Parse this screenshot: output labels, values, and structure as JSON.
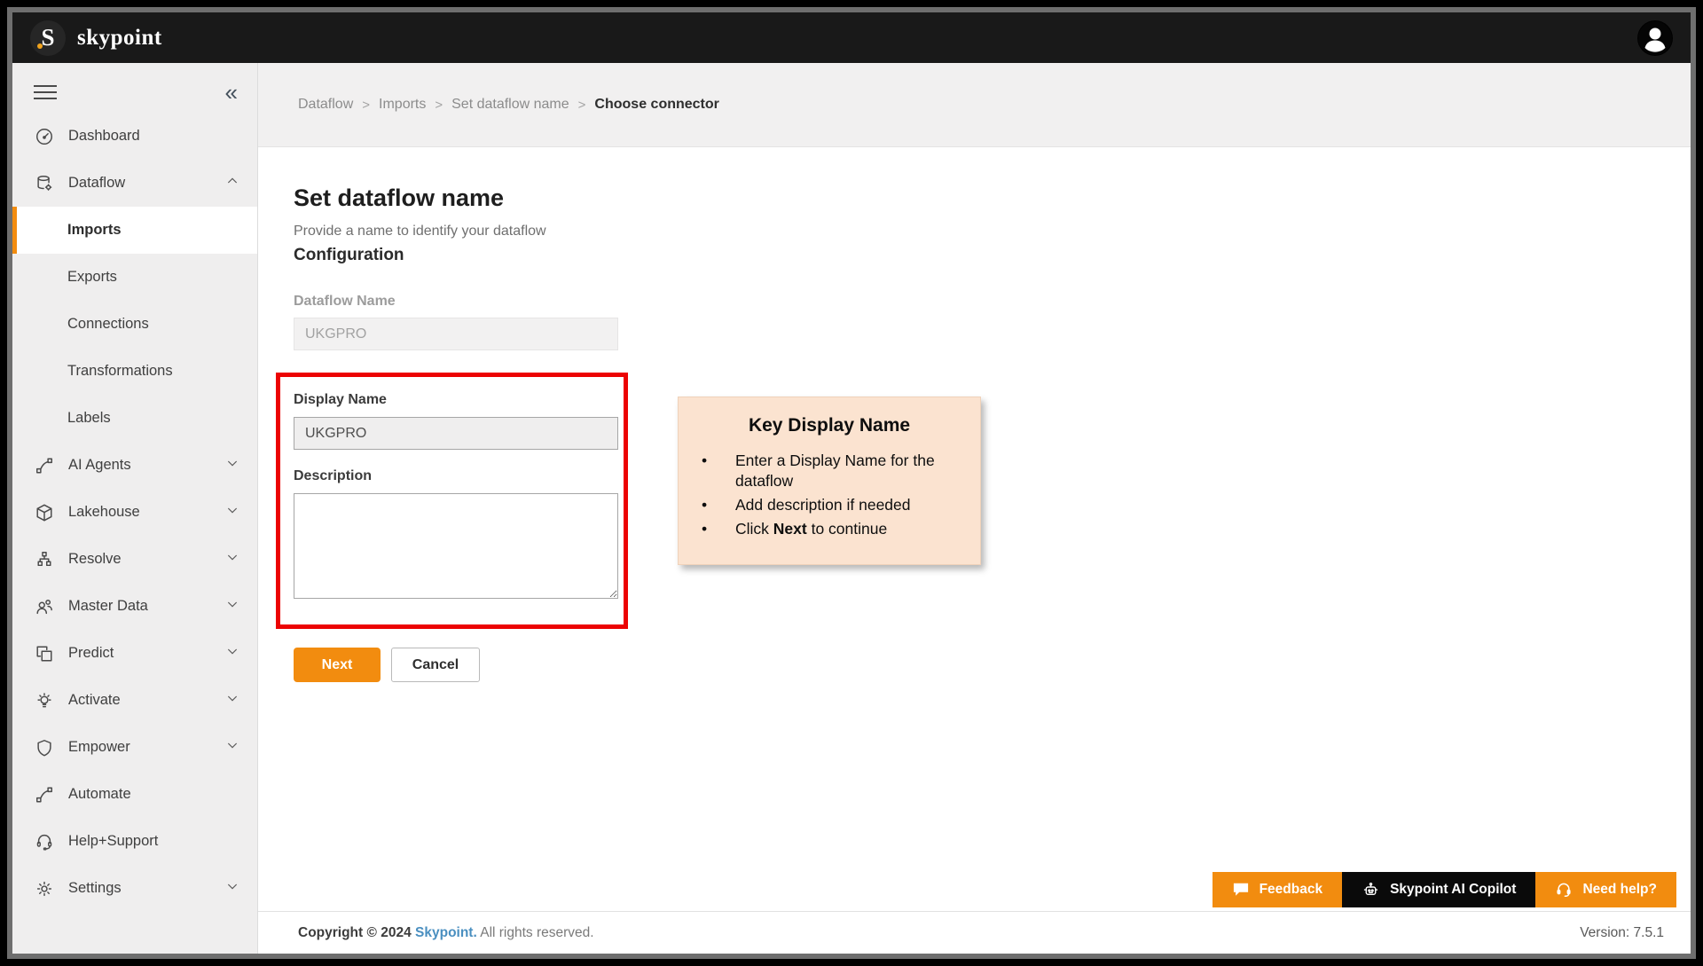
{
  "topbar": {
    "logo_letter": "S",
    "brand": "skypoint"
  },
  "breadcrumb": {
    "items": [
      "Dataflow",
      "Imports",
      "Set dataflow name",
      "Choose connector"
    ],
    "separator": ">"
  },
  "sidebar": {
    "items": [
      {
        "label": "Dashboard",
        "icon": "dashboard"
      },
      {
        "label": "Dataflow",
        "icon": "dataflow",
        "chevron": "up"
      },
      {
        "label": "Imports",
        "child": true,
        "active": true
      },
      {
        "label": "Exports",
        "child": true
      },
      {
        "label": "Connections",
        "child": true
      },
      {
        "label": "Transformations",
        "child": true
      },
      {
        "label": "Labels",
        "child": true
      },
      {
        "label": "AI Agents",
        "icon": "ai-agents",
        "chevron": "down"
      },
      {
        "label": "Lakehouse",
        "icon": "lakehouse",
        "chevron": "down"
      },
      {
        "label": "Resolve",
        "icon": "resolve",
        "chevron": "down"
      },
      {
        "label": "Master Data",
        "icon": "master-data",
        "chevron": "down"
      },
      {
        "label": "Predict",
        "icon": "predict",
        "chevron": "down"
      },
      {
        "label": "Activate",
        "icon": "activate",
        "chevron": "down"
      },
      {
        "label": "Empower",
        "icon": "empower",
        "chevron": "down"
      },
      {
        "label": "Automate",
        "icon": "automate"
      },
      {
        "label": "Help+Support",
        "icon": "help-support"
      },
      {
        "label": "Settings",
        "icon": "settings",
        "chevron": "down"
      }
    ]
  },
  "page": {
    "title": "Set dataflow name",
    "subtitle": "Provide a name to identify your dataflow",
    "section": "Configuration"
  },
  "form": {
    "dataflow_name": {
      "label": "Dataflow Name",
      "value": "UKGPRO"
    },
    "display_name": {
      "label": "Display Name",
      "value": "UKGPRO"
    },
    "description": {
      "label": "Description",
      "value": ""
    },
    "next_label": "Next",
    "cancel_label": "Cancel"
  },
  "callout": {
    "title": "Key Display Name",
    "bullet_char": "•",
    "bullets": [
      {
        "pre": "Enter a Display Name for the dataflow",
        "bold": "",
        "post": ""
      },
      {
        "pre": "Add description if needed",
        "bold": "",
        "post": ""
      },
      {
        "pre": "Click ",
        "bold": "Next",
        "post": " to continue"
      }
    ]
  },
  "help_buttons": [
    {
      "label": "Feedback",
      "icon": "feedback-icon"
    },
    {
      "label": "Skypoint AI Copilot",
      "icon": "robot-icon"
    },
    {
      "label": "Need help?",
      "icon": "headset-icon"
    }
  ],
  "footer": {
    "copyright_prefix": "Copyright © 2024 ",
    "brand_link": "Skypoint.",
    "copyright_suffix": " All rights reserved.",
    "version": "Version: 7.5.1"
  },
  "colors": {
    "accent_orange": "#f28c0f",
    "highlight_red": "#ec0303",
    "callout_bg": "#fbe3d0",
    "topbar_bg": "#191919",
    "sidebar_bg": "#efeeee",
    "link_blue": "#4a8fc0"
  }
}
